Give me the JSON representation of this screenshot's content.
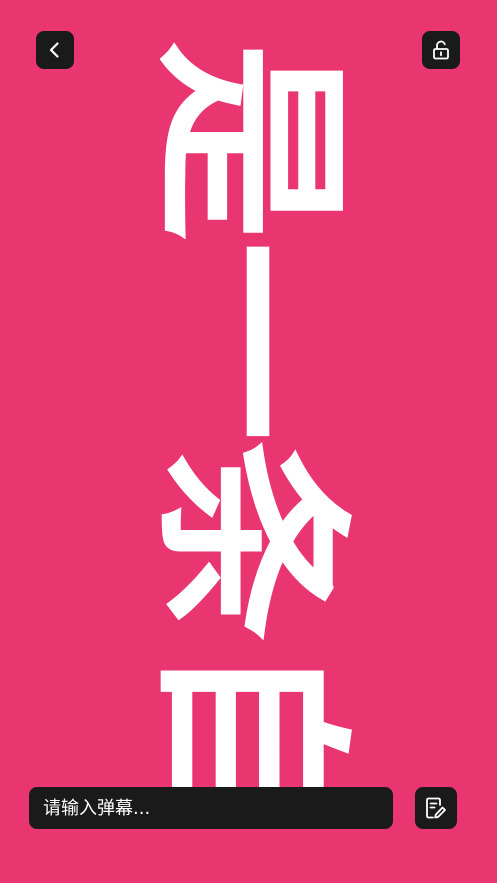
{
  "danmaku": {
    "text": "是一条自"
  },
  "toolbar": {
    "back_icon": "chevron-left-icon",
    "lock_icon": "unlock-icon",
    "edit_icon": "edit-note-icon"
  },
  "composer": {
    "placeholder": "请输入弹幕..."
  },
  "colors": {
    "background": "#e93570",
    "text": "#ffffff",
    "control_bg": "#1a1a1a"
  }
}
